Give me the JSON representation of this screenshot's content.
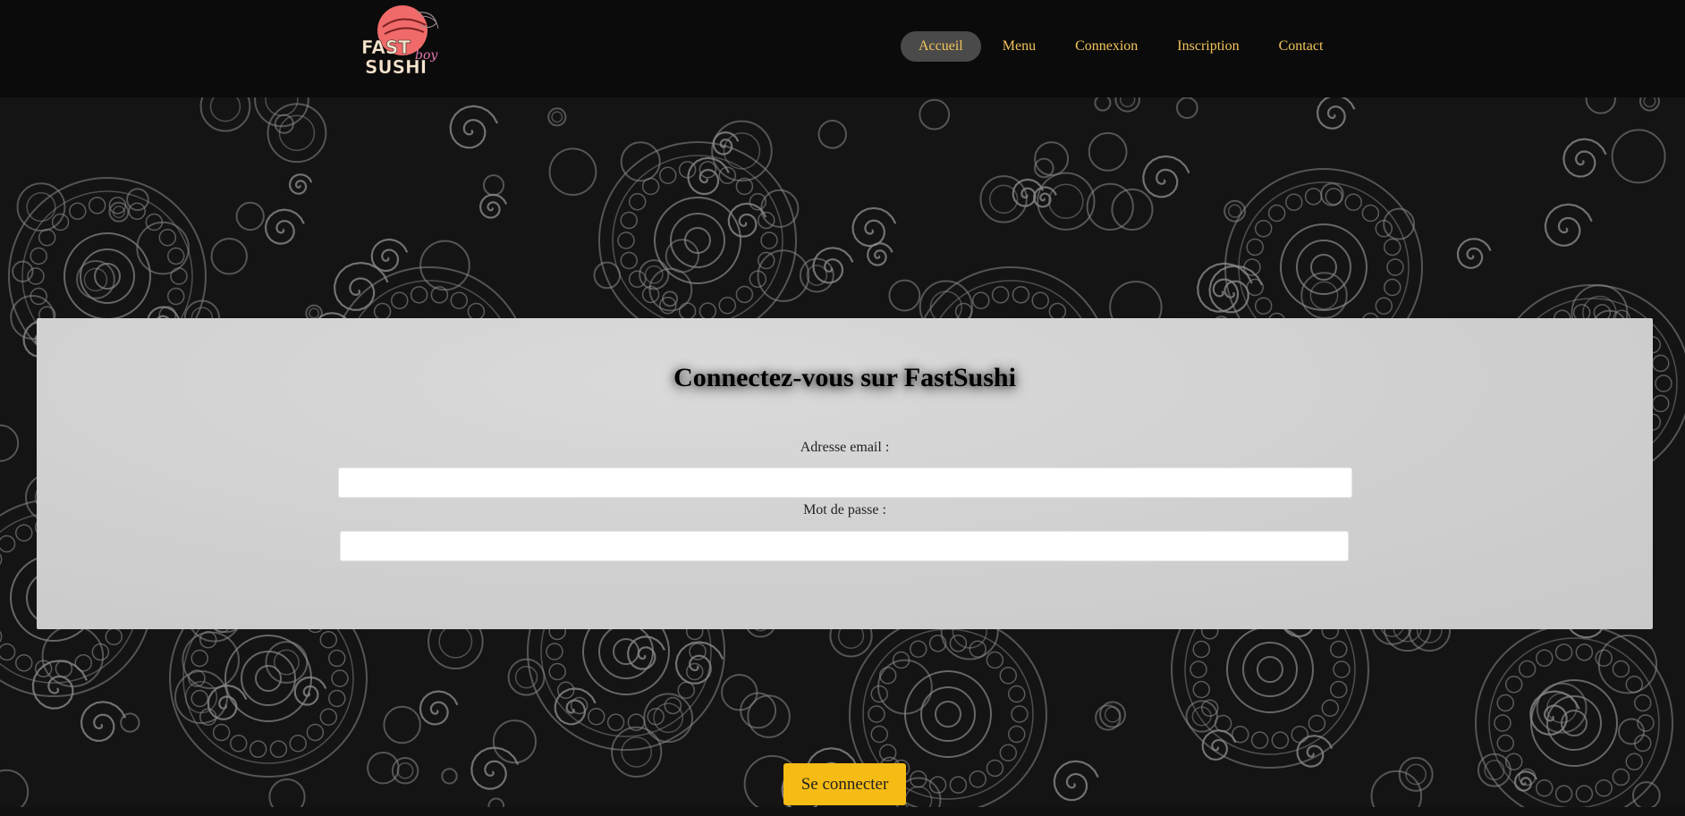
{
  "brand": {
    "logo_line1": "FAST",
    "logo_line2": "SUSHI",
    "logo_script": "boy"
  },
  "nav": [
    {
      "label": "Accueil",
      "active": true
    },
    {
      "label": "Menu",
      "active": false
    },
    {
      "label": "Connexion",
      "active": false
    },
    {
      "label": "Inscription",
      "active": false
    },
    {
      "label": "Contact",
      "active": false
    }
  ],
  "login": {
    "title": "Connectez-vous sur FastSushi",
    "email_label": "Adresse email :",
    "email_value": "",
    "password_label": "Mot de passe :",
    "password_value": "",
    "submit_label": "Se connecter"
  },
  "colors": {
    "accent": "#f6bc14",
    "nav_text": "#f4c55a",
    "nav_active_bg": "#4a4a4a",
    "header_bg": "#0b0b0b",
    "logo_circle": "#f26b6b"
  },
  "icons": {
    "logo": "sushi-logo-icon",
    "background": "paisley-pattern"
  }
}
